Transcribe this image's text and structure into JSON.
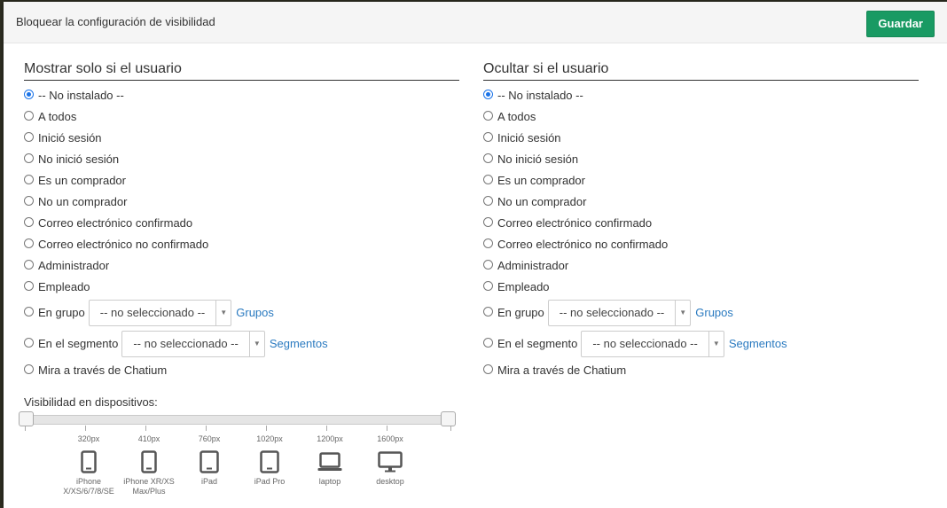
{
  "dialog": {
    "title": "Bloquear la configuración de visibilidad",
    "save_label": "Guardar",
    "accent_color": "#199a63"
  },
  "show_column": {
    "title": "Mostrar solo si el usuario",
    "options": [
      "-- No instalado --",
      "A todos",
      "Inició sesión",
      "No inició sesión",
      "Es un comprador",
      "No un comprador",
      "Correo electrónico confirmado",
      "Correo electrónico no confirmado",
      "Administrador",
      "Empleado",
      "En grupo",
      "En el segmento",
      "Mira a través de Chatium"
    ],
    "selected_index": 0,
    "group_select": "-- no seleccionado --",
    "group_link": "Grupos",
    "segment_select": "-- no seleccionado --",
    "segment_link": "Segmentos"
  },
  "hide_column": {
    "title": "Ocultar si el usuario",
    "options": [
      "-- No instalado --",
      "A todos",
      "Inició sesión",
      "No inició sesión",
      "Es un comprador",
      "No un comprador",
      "Correo electrónico confirmado",
      "Correo electrónico no confirmado",
      "Administrador",
      "Empleado",
      "En grupo",
      "En el segmento",
      "Mira a través de Chatium"
    ],
    "selected_index": 0,
    "group_select": "-- no seleccionado --",
    "group_link": "Grupos",
    "segment_select": "-- no seleccionado --",
    "segment_link": "Segmentos"
  },
  "devices": {
    "label": "Visibilidad en dispositivos:",
    "items": [
      {
        "px": "320px",
        "icon": "phone-icon",
        "name": "iPhone X/XS/6/7/8/SE"
      },
      {
        "px": "410px",
        "icon": "phone-icon",
        "name": "iPhone XR/XS Max/Plus"
      },
      {
        "px": "760px",
        "icon": "tablet-icon",
        "name": "iPad"
      },
      {
        "px": "1020px",
        "icon": "tablet-icon",
        "name": "iPad Pro"
      },
      {
        "px": "1200px",
        "icon": "laptop-icon",
        "name": "laptop"
      },
      {
        "px": "1600px",
        "icon": "desktop-icon",
        "name": "desktop"
      }
    ],
    "range_min_fraction": 0,
    "range_max_fraction": 1
  }
}
